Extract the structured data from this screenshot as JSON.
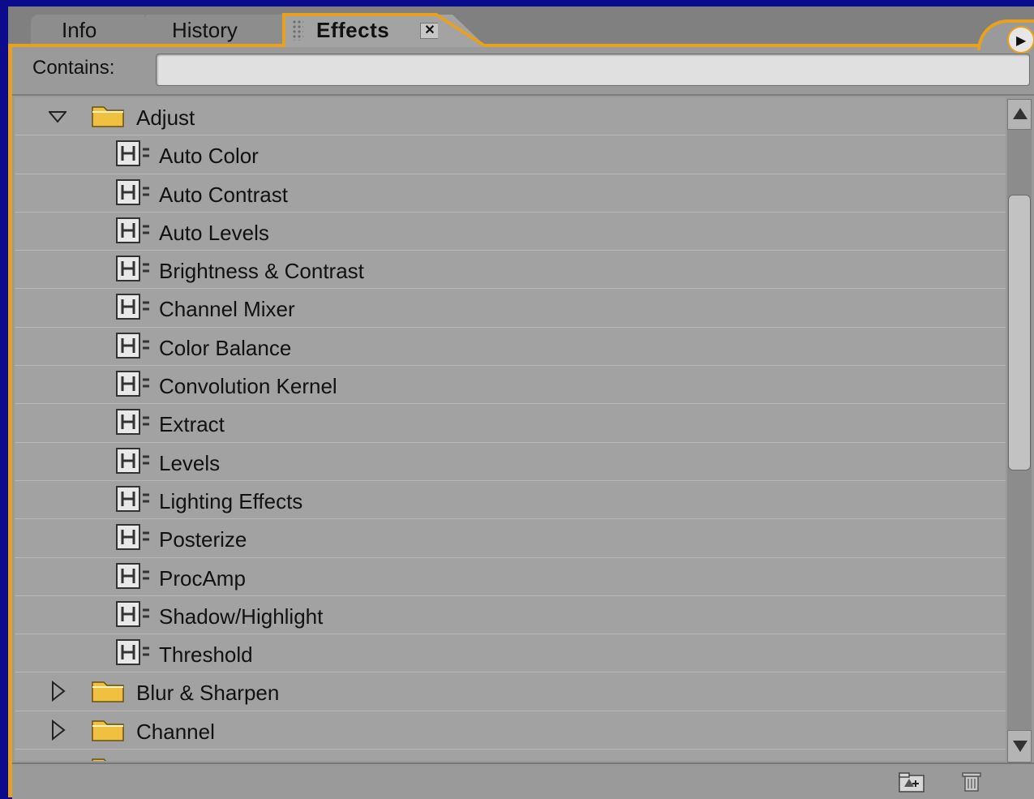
{
  "tabs": [
    {
      "label": "Info",
      "active": false
    },
    {
      "label": "History",
      "active": false
    },
    {
      "label": "Effects",
      "active": true
    }
  ],
  "close_glyph": "✕",
  "panel_menu_icon": "panel-menu-icon",
  "search": {
    "label": "Contains:",
    "value": "",
    "placeholder": ""
  },
  "tree": {
    "adjust": {
      "label": "Adjust",
      "expanded": true,
      "items": [
        "Auto Color",
        "Auto Contrast",
        "Auto Levels",
        "Brightness & Contrast",
        "Channel Mixer",
        "Color Balance",
        "Convolution Kernel",
        "Extract",
        "Levels",
        "Lighting Effects",
        "Posterize",
        "ProcAmp",
        "Shadow/Highlight",
        "Threshold"
      ]
    },
    "collapsed_folders": [
      "Blur & Sharpen",
      "Channel"
    ]
  },
  "colors": {
    "background": "#0b0b8c",
    "panel": "#9a9a9a",
    "accent": "#e8a020",
    "folder": "#f0c040"
  },
  "bottom_icons": [
    "new-bin-icon",
    "trash-icon"
  ]
}
